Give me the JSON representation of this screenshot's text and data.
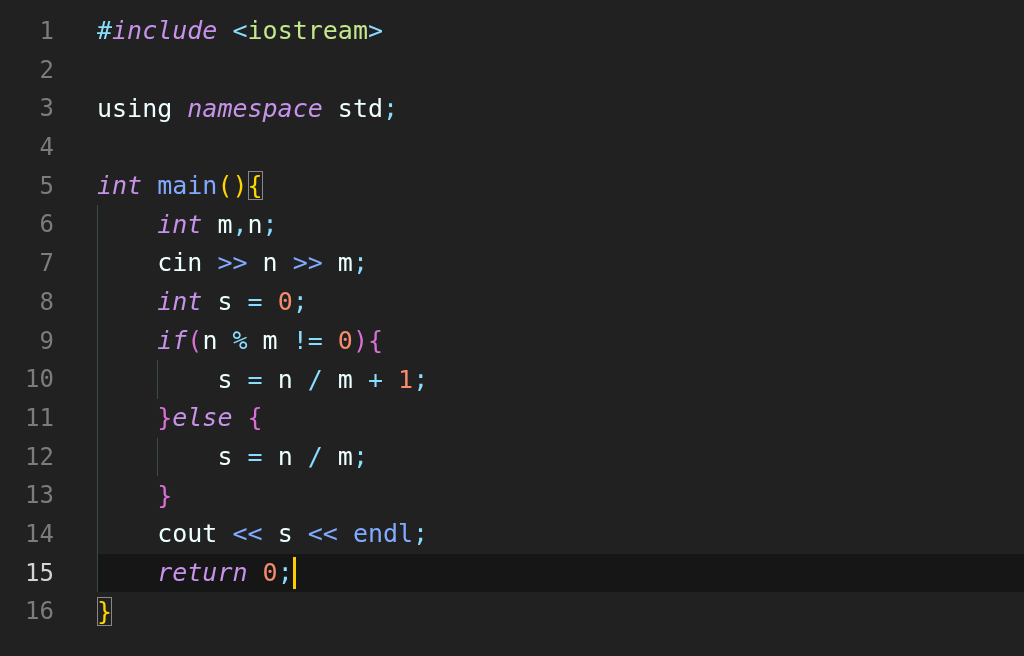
{
  "editor": {
    "lines": [
      {
        "number": "1",
        "current": false,
        "tokens": [
          {
            "text": "#",
            "kind": "punct"
          },
          {
            "text": "include ",
            "kind": "keyword"
          },
          {
            "text": "<",
            "kind": "punct"
          },
          {
            "text": "iostream",
            "kind": "string"
          },
          {
            "text": ">",
            "kind": "punct"
          }
        ]
      },
      {
        "number": "2",
        "current": false
      },
      {
        "number": "3",
        "current": false,
        "tokens": [
          {
            "text": "using ",
            "kind": "plain"
          },
          {
            "text": "namespace",
            "kind": "keyword"
          },
          {
            "text": " std",
            "kind": "plain"
          },
          {
            "text": ";",
            "kind": "punct"
          }
        ]
      },
      {
        "number": "4",
        "current": false
      },
      {
        "number": "5",
        "current": false,
        "tokens": [
          {
            "text": "int ",
            "kind": "keyword"
          },
          {
            "text": "main",
            "kind": "func"
          },
          {
            "text": "()",
            "kind": "bracket1"
          },
          {
            "text": "{",
            "kind": "bracket-match"
          }
        ]
      },
      {
        "number": "6",
        "current": false,
        "tokens": [
          {
            "text": "    int",
            "kind": "keyword"
          },
          {
            "text": " m",
            "kind": "plain"
          },
          {
            "text": ",",
            "kind": "punct"
          },
          {
            "text": "n",
            "kind": "plain"
          },
          {
            "text": ";",
            "kind": "punct"
          }
        ]
      },
      {
        "number": "7",
        "current": false,
        "tokens": [
          {
            "text": "    cin ",
            "kind": "plain"
          },
          {
            "text": ">>",
            "kind": "op"
          },
          {
            "text": " n ",
            "kind": "plain"
          },
          {
            "text": ">>",
            "kind": "op"
          },
          {
            "text": " m",
            "kind": "plain"
          },
          {
            "text": ";",
            "kind": "punct"
          }
        ]
      },
      {
        "number": "8",
        "current": false,
        "tokens": [
          {
            "text": "    int",
            "kind": "keyword"
          },
          {
            "text": " s ",
            "kind": "plain"
          },
          {
            "text": "= ",
            "kind": "punct"
          },
          {
            "text": "0",
            "kind": "number"
          },
          {
            "text": ";",
            "kind": "punct"
          }
        ]
      },
      {
        "number": "9",
        "current": false,
        "tokens": [
          {
            "text": "    if",
            "kind": "keyword"
          },
          {
            "text": "(",
            "kind": "bracket2"
          },
          {
            "text": "n ",
            "kind": "plain"
          },
          {
            "text": "%",
            "kind": "punct"
          },
          {
            "text": " m ",
            "kind": "plain"
          },
          {
            "text": "!= ",
            "kind": "punct"
          },
          {
            "text": "0",
            "kind": "number"
          },
          {
            "text": "){",
            "kind": "bracket2"
          }
        ]
      },
      {
        "number": "10",
        "current": false,
        "tokens": [
          {
            "text": "        s ",
            "kind": "plain"
          },
          {
            "text": "=",
            "kind": "punct"
          },
          {
            "text": " n ",
            "kind": "plain"
          },
          {
            "text": "/",
            "kind": "punct"
          },
          {
            "text": " m ",
            "kind": "plain"
          },
          {
            "text": "+ ",
            "kind": "punct"
          },
          {
            "text": "1",
            "kind": "number"
          },
          {
            "text": ";",
            "kind": "punct"
          }
        ]
      },
      {
        "number": "11",
        "current": false,
        "tokens": [
          {
            "text": "    }",
            "kind": "bracket2"
          },
          {
            "text": "else ",
            "kind": "keyword"
          },
          {
            "text": "{",
            "kind": "bracket2"
          }
        ]
      },
      {
        "number": "12",
        "current": false,
        "tokens": [
          {
            "text": "        s ",
            "kind": "plain"
          },
          {
            "text": "=",
            "kind": "punct"
          },
          {
            "text": " n ",
            "kind": "plain"
          },
          {
            "text": "/",
            "kind": "punct"
          },
          {
            "text": " m",
            "kind": "plain"
          },
          {
            "text": ";",
            "kind": "punct"
          }
        ]
      },
      {
        "number": "13",
        "current": false,
        "tokens": [
          {
            "text": "    }",
            "kind": "bracket2"
          }
        ]
      },
      {
        "number": "14",
        "current": false,
        "tokens": [
          {
            "text": "    cout ",
            "kind": "plain"
          },
          {
            "text": "<<",
            "kind": "op"
          },
          {
            "text": " s ",
            "kind": "plain"
          },
          {
            "text": "<< ",
            "kind": "op"
          },
          {
            "text": "endl",
            "kind": "func"
          },
          {
            "text": ";",
            "kind": "punct"
          }
        ]
      },
      {
        "number": "15",
        "current": true,
        "tokens": [
          {
            "text": "    return ",
            "kind": "keyword"
          },
          {
            "text": "0",
            "kind": "number"
          },
          {
            "text": ";",
            "kind": "punct"
          }
        ]
      },
      {
        "number": "16",
        "current": false,
        "tokens": [
          {
            "text": "}",
            "kind": "bracket-match"
          }
        ]
      }
    ]
  }
}
